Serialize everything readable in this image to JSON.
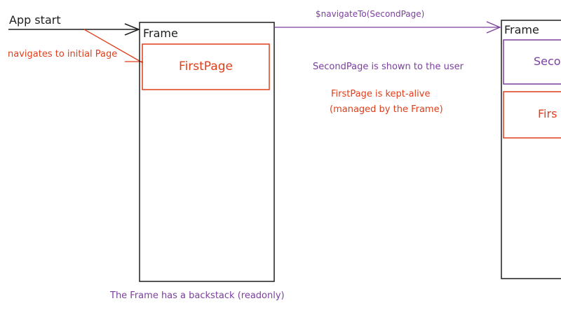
{
  "labels": {
    "app_start": "App start",
    "navigates_to_initial": "navigates to initial Page",
    "frame_left_title": "Frame",
    "first_page_left": "FirstPage",
    "navigate_call": "$navigateTo(SecondPage)",
    "second_shown": "SecondPage is shown to the user",
    "first_kept_alive_1": "FirstPage is kept-alive",
    "first_kept_alive_2": "(managed by the Frame)",
    "frame_right_title": "Frame",
    "second_page_right": "Secon",
    "first_page_right": "Firs",
    "backstack_note": "The Frame has a backstack (readonly)"
  },
  "colors": {
    "ink": "#1e1e1e",
    "red": "#e03e1a",
    "purple": "#7b3fa0"
  }
}
